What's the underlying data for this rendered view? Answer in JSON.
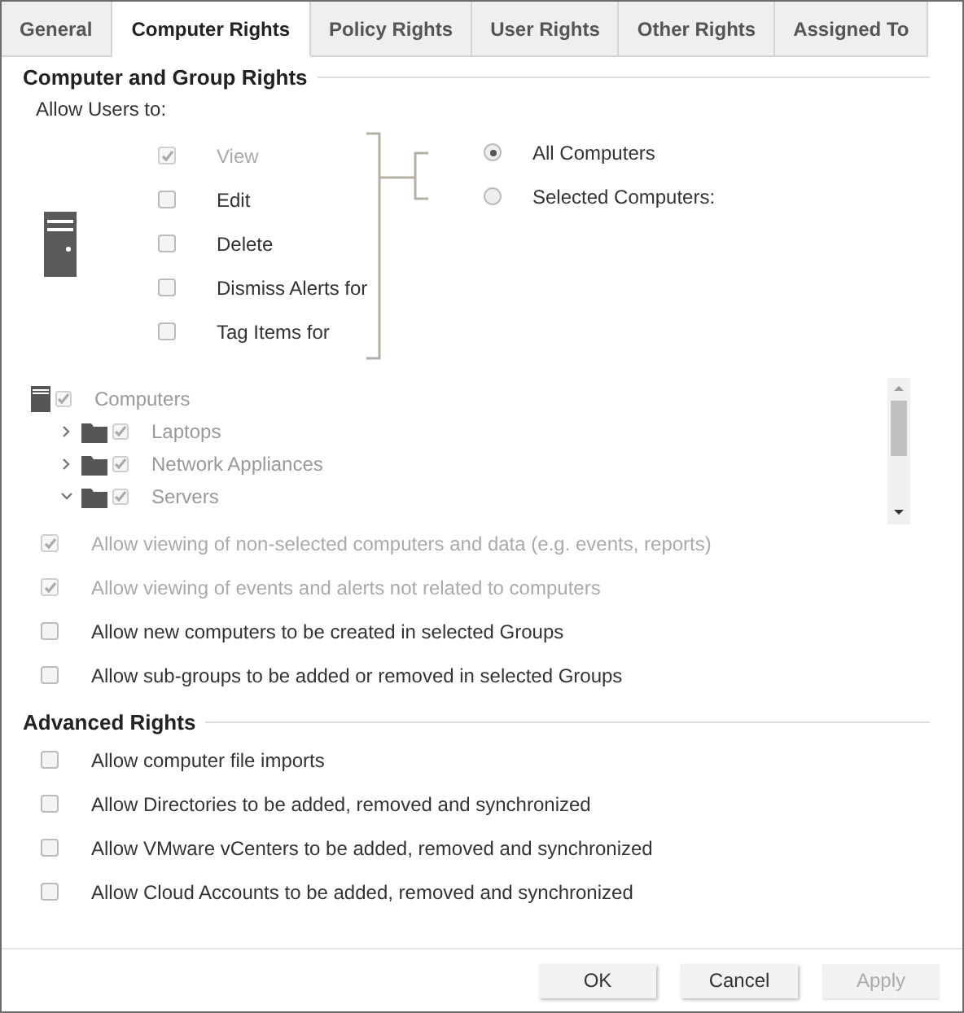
{
  "tabs": [
    {
      "label": "General",
      "selected": false
    },
    {
      "label": "Computer Rights",
      "selected": true
    },
    {
      "label": "Policy Rights",
      "selected": false
    },
    {
      "label": "User Rights",
      "selected": false
    },
    {
      "label": "Other Rights",
      "selected": false
    },
    {
      "label": "Assigned To",
      "selected": false
    }
  ],
  "computer_group_rights": {
    "title": "Computer and Group Rights",
    "subtitle": "Allow Users to:",
    "permissions": [
      {
        "label": "View",
        "checked": true,
        "disabled": true
      },
      {
        "label": "Edit",
        "checked": false,
        "disabled": false
      },
      {
        "label": "Delete",
        "checked": false,
        "disabled": false
      },
      {
        "label": "Dismiss Alerts for",
        "checked": false,
        "disabled": false
      },
      {
        "label": "Tag Items for",
        "checked": false,
        "disabled": false
      }
    ],
    "scope": [
      {
        "label": "All Computers",
        "selected": true
      },
      {
        "label": "Selected Computers:",
        "selected": false
      }
    ],
    "tree": [
      {
        "label": "Computers",
        "kind": "root",
        "checked": true,
        "children": [
          {
            "label": "Laptops",
            "kind": "group",
            "checked": true,
            "expanded": false
          },
          {
            "label": "Network Appliances",
            "kind": "group",
            "checked": true,
            "expanded": false
          },
          {
            "label": "Servers",
            "kind": "group",
            "checked": true,
            "expanded": true
          }
        ]
      }
    ],
    "options": [
      {
        "label": "Allow viewing of non-selected computers and data (e.g. events, reports)",
        "checked": true,
        "disabled": true
      },
      {
        "label": "Allow viewing of events and alerts not related to computers",
        "checked": true,
        "disabled": true
      },
      {
        "label": "Allow new computers to be created in selected Groups",
        "checked": false,
        "disabled": false
      },
      {
        "label": "Allow sub-groups to be added or removed in selected Groups",
        "checked": false,
        "disabled": false
      }
    ]
  },
  "advanced_rights": {
    "title": "Advanced Rights",
    "options": [
      {
        "label": "Allow computer file imports",
        "checked": false
      },
      {
        "label": "Allow Directories to be added, removed and synchronized",
        "checked": false
      },
      {
        "label": "Allow VMware vCenters to be added, removed and synchronized",
        "checked": false
      },
      {
        "label": "Allow Cloud Accounts to be added, removed and synchronized",
        "checked": false
      }
    ]
  },
  "buttons": [
    {
      "label": "OK",
      "disabled": false
    },
    {
      "label": "Cancel",
      "disabled": false
    },
    {
      "label": "Apply",
      "disabled": true
    }
  ]
}
